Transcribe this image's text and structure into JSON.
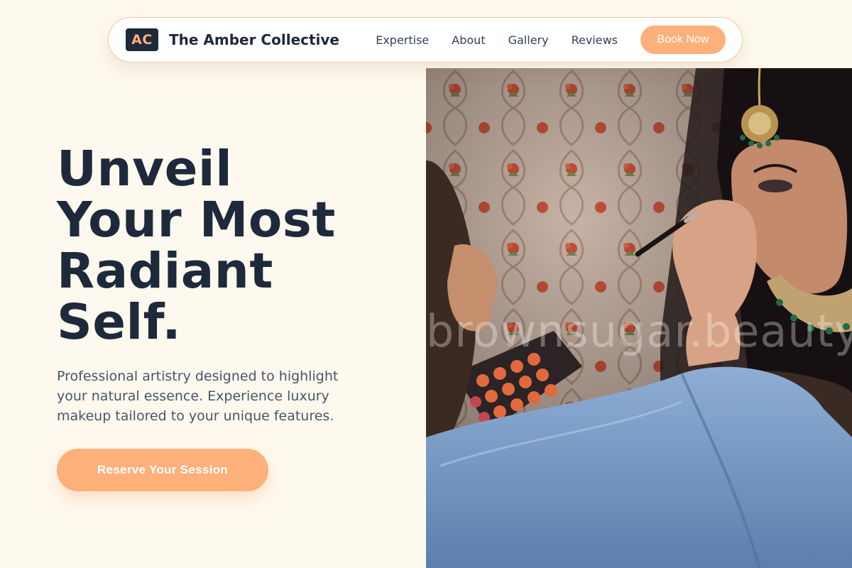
{
  "nav": {
    "logo_text": "AC",
    "brand": "The Amber Collective",
    "links": [
      "Expertise",
      "About",
      "Gallery",
      "Reviews"
    ],
    "cta_label": "Book Now"
  },
  "hero": {
    "title_lines": [
      "Unveil",
      "Your Most",
      "Radiant",
      "Self."
    ],
    "subtitle": "Professional artistry designed to highlight your natural essence. Experience luxury makeup tailored to your unique features.",
    "cta_label": "Reserve Your Session",
    "image_watermark": "brownsugar.beauty"
  },
  "colors": {
    "background": "#FEF9EE",
    "accent": "#FDB07A",
    "dark": "#1E293B",
    "muted_text": "#475569"
  }
}
